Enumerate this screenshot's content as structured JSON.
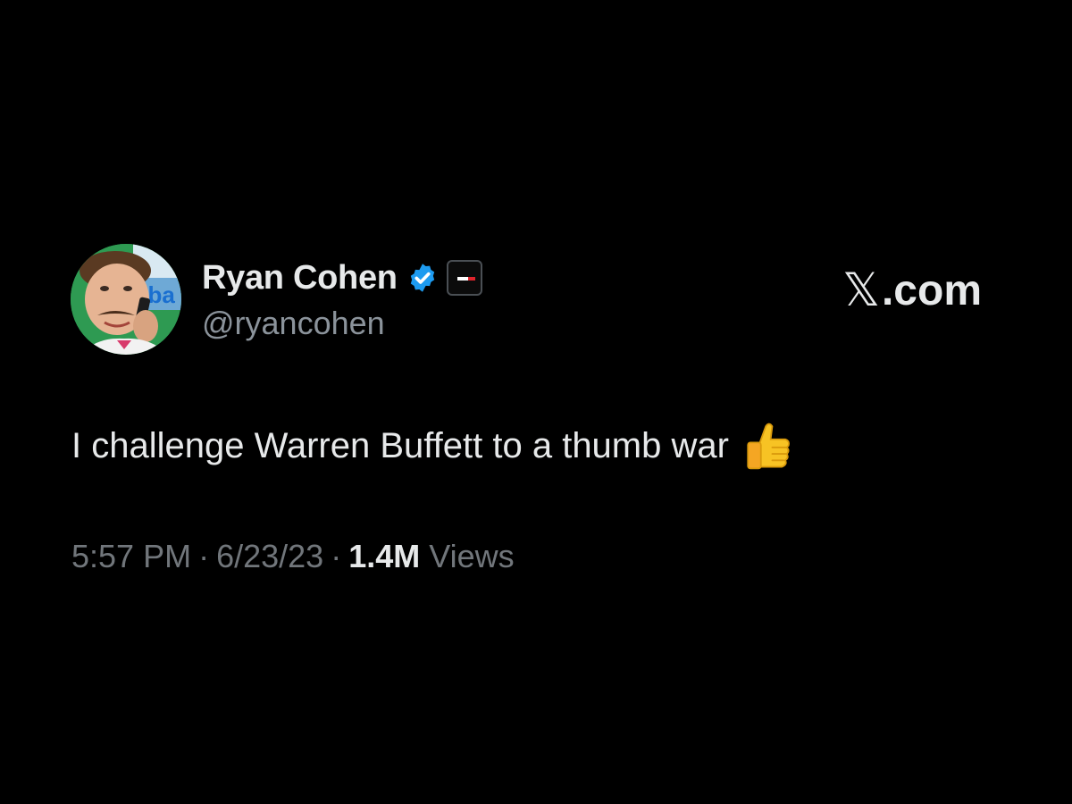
{
  "tweet": {
    "author": {
      "name": "Ryan Cohen",
      "handle": "@ryancohen",
      "avatar_sign_text": "eba"
    },
    "brand": {
      "x_symbol": "𝕏",
      "domain": ".com"
    },
    "text": "I challenge Warren Buffett to a thumb war",
    "emoji": "thumbs-up-emoji",
    "meta": {
      "time": "5:57 PM",
      "separator": "·",
      "date": "6/23/23",
      "views_count": "1.4M",
      "views_label": "Views"
    }
  },
  "colors": {
    "background": "#000000",
    "primary_text": "#e7e9ea",
    "secondary_text": "#71767b",
    "verified_blue": "#1d9bf0",
    "emoji_yellow": "#f7c324"
  },
  "icons": [
    "verified-badge-icon",
    "affiliate-badge-icon",
    "thumbs-up-icon"
  ]
}
